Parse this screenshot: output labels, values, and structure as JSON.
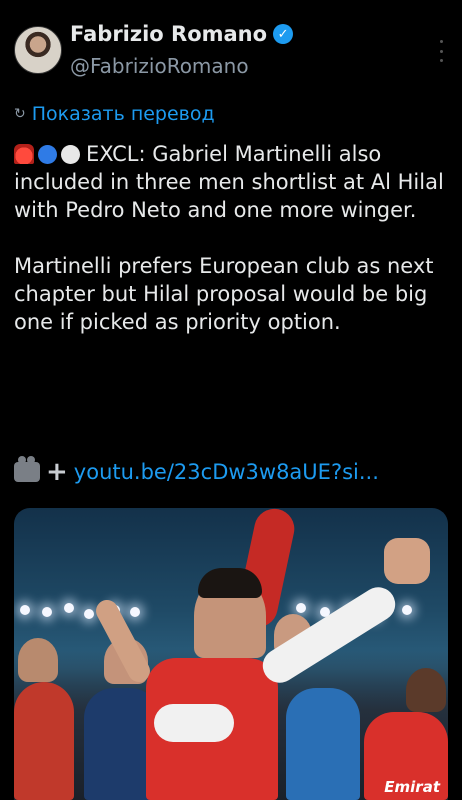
{
  "tweet": {
    "author": {
      "display_name": "Fabrizio Romano",
      "handle": "@FabrizioRomano",
      "verified": true
    },
    "translate_label": "Показать перевод",
    "text_line1_lead": "EXCL: Gabriel Martinelli",
    "text_paragraph1_rest": "also included in three men shortlist at Al Hilal with Pedro Neto and one more winger.",
    "text_paragraph2": "Martinelli prefers European club as next chapter but Hilal proposal would be big one if picked as priority option.",
    "link_text": "youtu.be/23cDw3w8aUE?si...",
    "emoji_icons": [
      "siren-icon",
      "blue-circle-icon",
      "white-circle-icon"
    ],
    "link_icons": [
      "video-camera-icon",
      "plus-icon"
    ],
    "media_overlay_text": "Emirat"
  },
  "colors": {
    "background": "#000000",
    "text": "#e7e9ea",
    "muted": "#8b98a5",
    "link": "#1d9bf0"
  }
}
